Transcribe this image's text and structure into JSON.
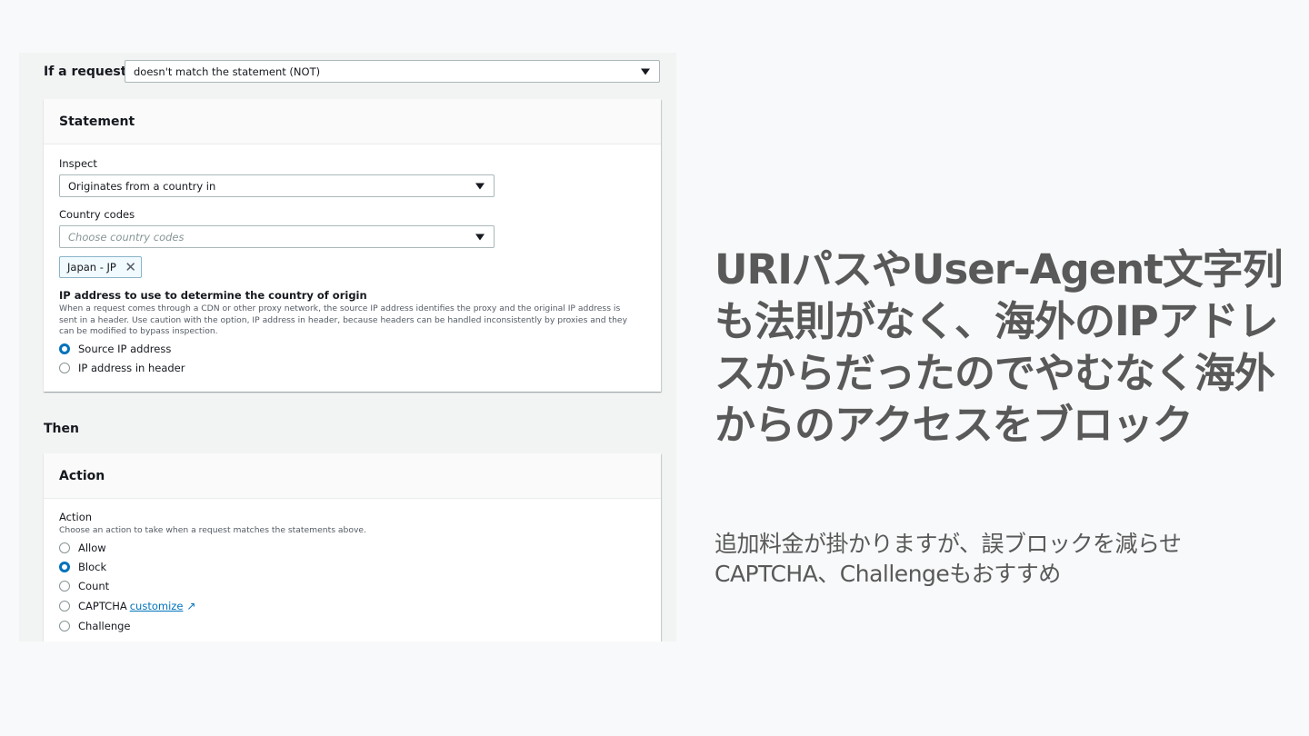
{
  "rule": {
    "if_label": "If a request",
    "match_select": "doesn't match the statement (NOT)"
  },
  "statement": {
    "header": "Statement",
    "inspect_label": "Inspect",
    "inspect_value": "Originates from a country in",
    "country_codes_label": "Country codes",
    "country_codes_placeholder": "Choose country codes",
    "token": "Japan - JP",
    "ip_label": "IP address to use to determine the country of origin",
    "ip_desc": "When a request comes through a CDN or other proxy network, the source IP address identifies the proxy and the original IP address is sent in a header. Use caution with the option, IP address in header, because headers can be handled inconsistently by proxies and they can be modified to bypass inspection.",
    "ip_options": [
      {
        "label": "Source IP address",
        "selected": true
      },
      {
        "label": "IP address in header",
        "selected": false
      }
    ]
  },
  "then_label": "Then",
  "action": {
    "header": "Action",
    "label": "Action",
    "desc": "Choose an action to take when a request matches the statements above.",
    "options": [
      {
        "label": "Allow",
        "selected": false
      },
      {
        "label": "Block",
        "selected": true
      },
      {
        "label": "Count",
        "selected": false
      },
      {
        "label": "CAPTCHA",
        "selected": false,
        "link": "customize"
      },
      {
        "label": "Challenge",
        "selected": false
      }
    ]
  },
  "slide": {
    "headline": "URIパスやUser-Agent文字列も法則がなく、海外のIPアドレスからだったのでやむなく海外からのアクセスをブロック",
    "subtext": "追加料金が掛かりますが、誤ブロックを減らせCAPTCHA、Challengeもおすすめ",
    "text_color": "#595959",
    "accent_color": "#0073bb"
  }
}
